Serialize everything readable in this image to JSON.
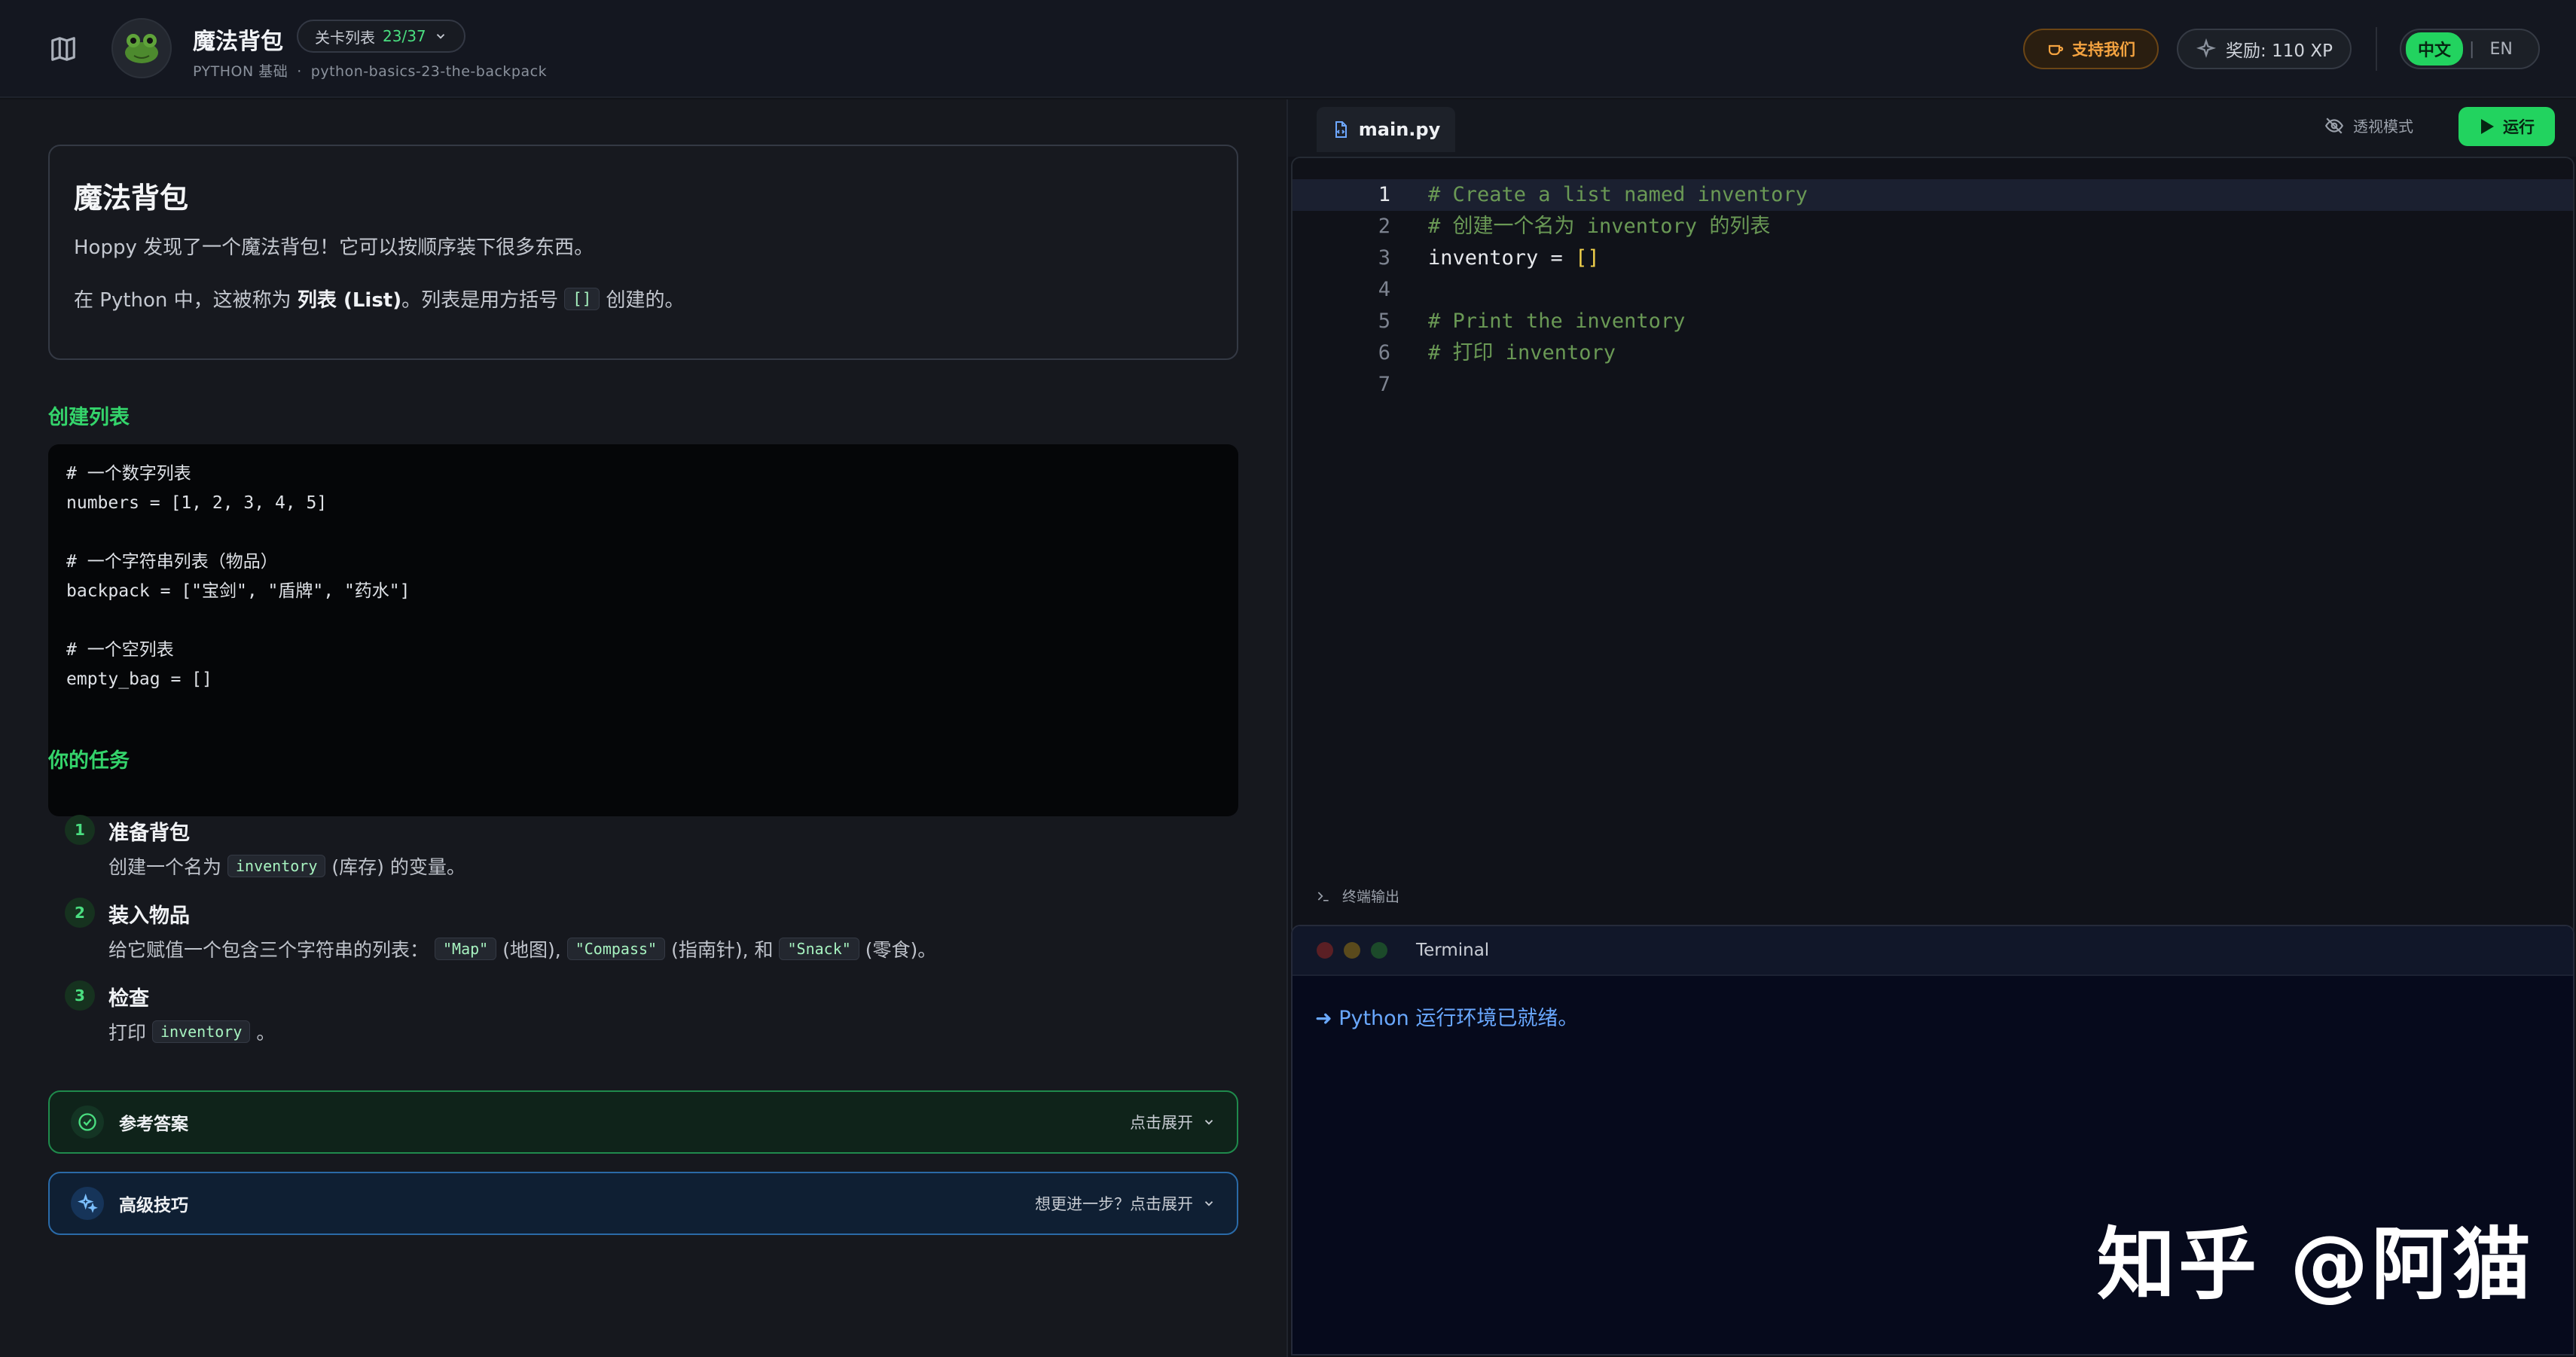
{
  "header": {
    "title": "魔法背包",
    "level_label": "关卡列表",
    "level_count": "23/37",
    "course": "PYTHON 基础",
    "slug": "python-basics-23-the-backpack",
    "support_label": "支持我们",
    "reward_label": "奖励: 110 XP",
    "lang_zh": "中文",
    "lang_sep": "|",
    "lang_en": "EN"
  },
  "intro": {
    "title": "魔法背包",
    "p1": "Hoppy 发现了一个魔法背包！它可以按顺序装下很多东西。",
    "p2_pre": "在 Python 中，这被称为",
    "p2_bold": "列表 (List)",
    "p2_mid": "。列表是用方括号",
    "p2_code": "[]",
    "p2_post": "创建的。"
  },
  "section_create": "创建列表",
  "example_code": [
    "# 一个数字列表",
    "numbers = [1, 2, 3, 4, 5]",
    "",
    "# 一个字符串列表（物品）",
    "backpack = [\"宝剑\", \"盾牌\", \"药水\"]",
    "",
    "# 一个空列表",
    "empty_bag = []"
  ],
  "section_task": "你的任务",
  "tasks": [
    {
      "num": "1",
      "title": "准备背包",
      "d_pre": "创建一个名为",
      "d_code": "inventory",
      "d_post": "(库存) 的变量。"
    },
    {
      "num": "2",
      "title": "装入物品",
      "d_pre": "给它赋值一个包含三个字符串的列表：",
      "c1": "\"Map\"",
      "t1": "(地图),",
      "c2": "\"Compass\"",
      "t2": "(指南针), 和",
      "c3": "\"Snack\"",
      "t3": "(零食)。"
    },
    {
      "num": "3",
      "title": "检查",
      "d_pre": "打印",
      "d_code": "inventory",
      "d_post": "。"
    }
  ],
  "answer": {
    "label": "参考答案",
    "action": "点击展开"
  },
  "tips": {
    "label": "高级技巧",
    "action": "想更进一步？点击展开"
  },
  "editor": {
    "file_name": "main.py",
    "xray_label": "透视模式",
    "run_label": "运行",
    "lines": [
      {
        "n": "1",
        "text": "# Create a list named inventory"
      },
      {
        "n": "2",
        "text": "# 创建一个名为 inventory 的列表"
      },
      {
        "n": "3",
        "text": "inventory = ",
        "bracket": "[]"
      },
      {
        "n": "4",
        "text": ""
      },
      {
        "n": "5",
        "text": "# Print the inventory"
      },
      {
        "n": "6",
        "text": "# 打印 inventory"
      },
      {
        "n": "7",
        "text": ""
      }
    ]
  },
  "terminal": {
    "section_label": "终端输出",
    "title": "Terminal",
    "output": "➜ Python 运行环境已就绪。"
  },
  "watermark": "知乎 @阿猫",
  "colors": {
    "accent": "#22d35f",
    "support": "#f4a340",
    "link_blue": "#69a8ff"
  }
}
